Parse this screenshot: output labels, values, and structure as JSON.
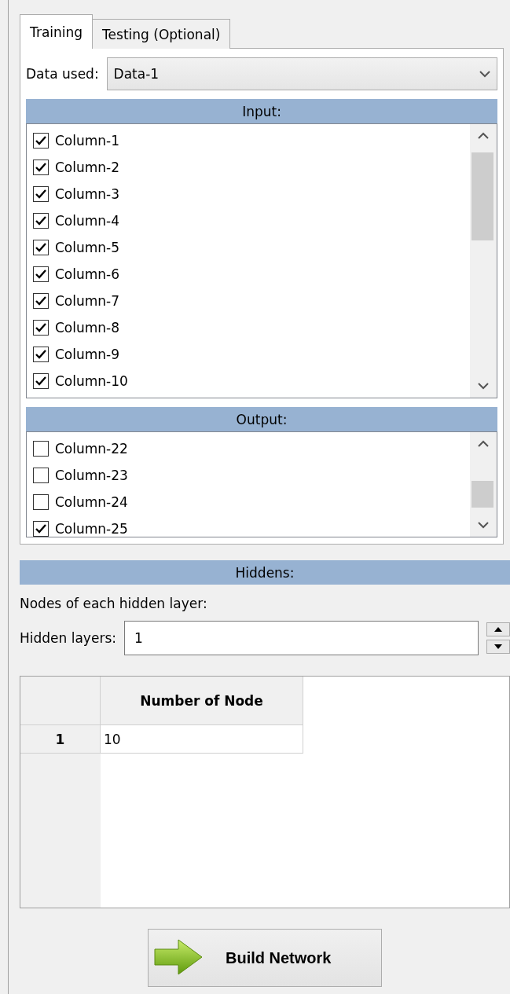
{
  "tabs": [
    {
      "label": "Training",
      "selected": true
    },
    {
      "label": "Testing (Optional)",
      "selected": false
    }
  ],
  "data_used": {
    "label": "Data used:",
    "value": "Data-1"
  },
  "input": {
    "title": "Input:",
    "items": [
      {
        "label": "Column-1",
        "checked": true
      },
      {
        "label": "Column-2",
        "checked": true
      },
      {
        "label": "Column-3",
        "checked": true
      },
      {
        "label": "Column-4",
        "checked": true
      },
      {
        "label": "Column-5",
        "checked": true
      },
      {
        "label": "Column-6",
        "checked": true
      },
      {
        "label": "Column-7",
        "checked": true
      },
      {
        "label": "Column-8",
        "checked": true
      },
      {
        "label": "Column-9",
        "checked": true
      },
      {
        "label": "Column-10",
        "checked": true
      }
    ]
  },
  "output": {
    "title": "Output:",
    "items": [
      {
        "label": "Column-22",
        "checked": false
      },
      {
        "label": "Column-23",
        "checked": false
      },
      {
        "label": "Column-24",
        "checked": false
      },
      {
        "label": "Column-25",
        "checked": true
      }
    ]
  },
  "hiddens": {
    "title": "Hiddens:",
    "nodes_label": "Nodes of each hidden layer:",
    "layers_label": "Hidden layers:",
    "layers_value": "1"
  },
  "table": {
    "columns": [
      "Number of Node"
    ],
    "rows": [
      {
        "header": "1",
        "cells": [
          "10"
        ]
      }
    ]
  },
  "build_button": "Build Network"
}
